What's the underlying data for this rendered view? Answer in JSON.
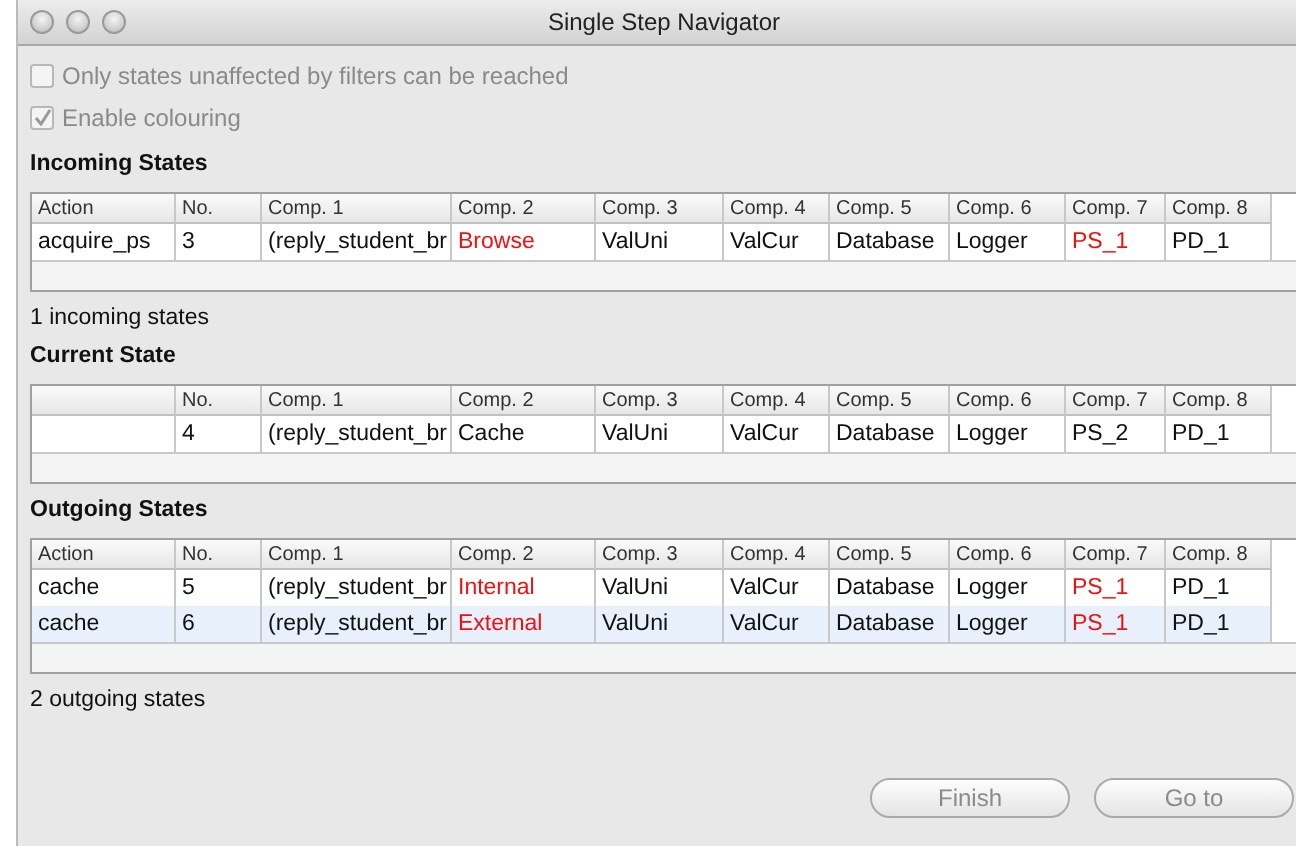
{
  "window": {
    "title": "Single Step Navigator"
  },
  "options": [
    {
      "label": "Only states unaffected by filters can be reached",
      "checked": false,
      "disabled": true
    },
    {
      "label": "Enable colouring",
      "checked": true,
      "disabled": true
    }
  ],
  "sections": [
    {
      "title": "Incoming States",
      "columns": [
        "Action",
        "No.",
        "Comp. 1",
        "Comp. 2",
        "Comp. 3",
        "Comp. 4",
        "Comp. 5",
        "Comp. 6",
        "Comp. 7",
        "Comp. 8"
      ],
      "rows": [
        {
          "selected": false,
          "cells": [
            {
              "text": "acquire_ps",
              "changed": false
            },
            {
              "text": "3",
              "changed": false
            },
            {
              "text": "(reply_student_br",
              "changed": false
            },
            {
              "text": "Browse",
              "changed": true
            },
            {
              "text": "ValUni",
              "changed": false
            },
            {
              "text": "ValCur",
              "changed": false
            },
            {
              "text": "Database",
              "changed": false
            },
            {
              "text": "Logger",
              "changed": false
            },
            {
              "text": "PS_1",
              "changed": true
            },
            {
              "text": "PD_1",
              "changed": false
            }
          ]
        }
      ],
      "summary": "1 incoming states"
    },
    {
      "title": "Current State",
      "columns": [
        "",
        "No.",
        "Comp. 1",
        "Comp. 2",
        "Comp. 3",
        "Comp. 4",
        "Comp. 5",
        "Comp. 6",
        "Comp. 7",
        "Comp. 8"
      ],
      "rows": [
        {
          "selected": false,
          "cells": [
            {},
            {
              "text": "4",
              "changed": false
            },
            {
              "text": "(reply_student_br",
              "changed": false
            },
            {
              "text": "Cache",
              "changed": false
            },
            {
              "text": "ValUni",
              "changed": false
            },
            {
              "text": "ValCur",
              "changed": false
            },
            {
              "text": "Database",
              "changed": false
            },
            {
              "text": "Logger",
              "changed": false
            },
            {
              "text": "PS_2",
              "changed": false
            },
            {
              "text": "PD_1",
              "changed": false
            }
          ]
        }
      ]
    },
    {
      "title": "Outgoing States",
      "columns": [
        "Action",
        "No.",
        "Comp. 1",
        "Comp. 2",
        "Comp. 3",
        "Comp. 4",
        "Comp. 5",
        "Comp. 6",
        "Comp. 7",
        "Comp. 8"
      ],
      "rows": [
        {
          "selected": false,
          "cells": [
            {
              "text": "cache",
              "changed": false
            },
            {
              "text": "5",
              "changed": false
            },
            {
              "text": "(reply_student_br",
              "changed": false
            },
            {
              "text": "Internal",
              "changed": true
            },
            {
              "text": "ValUni",
              "changed": false
            },
            {
              "text": "ValCur",
              "changed": false
            },
            {
              "text": "Database",
              "changed": false
            },
            {
              "text": "Logger",
              "changed": false
            },
            {
              "text": "PS_1",
              "changed": true
            },
            {
              "text": "PD_1",
              "changed": false
            }
          ]
        },
        {
          "selected": true,
          "cells": [
            {
              "text": "cache",
              "changed": false
            },
            {
              "text": "6",
              "changed": false
            },
            {
              "text": "(reply_student_br",
              "changed": false
            },
            {
              "text": "External",
              "changed": true
            },
            {
              "text": "ValUni",
              "changed": false
            },
            {
              "text": "ValCur",
              "changed": false
            },
            {
              "text": "Database",
              "changed": false
            },
            {
              "text": "Logger",
              "changed": false
            },
            {
              "text": "PS_1",
              "changed": true
            },
            {
              "text": "PD_1",
              "changed": false
            }
          ]
        }
      ],
      "summary": "2 outgoing states"
    }
  ],
  "buttons": [
    {
      "label": "Finish",
      "disabled": true
    },
    {
      "label": "Go to",
      "disabled": true
    }
  ]
}
